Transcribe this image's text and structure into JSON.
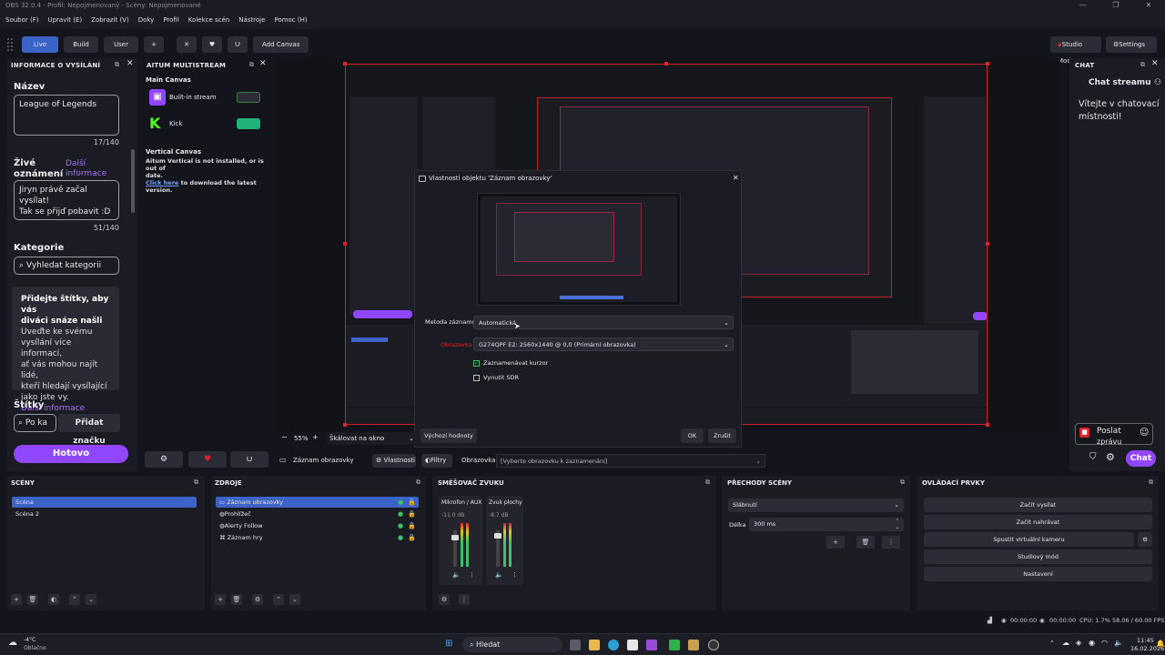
{
  "window": {
    "title": "OBS 32.0.4 - Profil: Nepojmenovaný - Scény: Nepojmenované",
    "controls": [
      "—",
      "❐",
      "✕"
    ]
  },
  "menubar": [
    "Soubor (F)",
    "Upravit (E)",
    "Zobrazit (V)",
    "Doky",
    "Profil",
    "Kolekce scén",
    "Nástroje",
    "Pomoc (H)"
  ],
  "toolbar": {
    "tabs": [
      "Live",
      "Build",
      "User"
    ],
    "active_tab": "Live",
    "add_tab": "+",
    "add_canvas": "Add Canvas",
    "studio_mode": "Studio Mode",
    "settings": "Settings"
  },
  "info_panel": {
    "title": "INFORMACE O VYSÍLÁNÍ",
    "name_label": "Název",
    "name_value": "League of Legends",
    "name_counter": "17/140",
    "live_label_1": "Živé",
    "live_label_2": "oznámení",
    "more_info_1": "Další",
    "more_info_2": "informace",
    "live_value_1": "Jiryn právě začal vysílat!",
    "live_value_2": "Tak se přijď pobavit :D",
    "live_counter": "51/140",
    "category_label": "Kategorie",
    "category_placeholder": "Vyhledat kategorii",
    "tip_bold_1": "Přidejte štítky, aby vás",
    "tip_bold_2": "diváci snáze našli",
    "tip_1": "Uveďte ke svému",
    "tip_2": "vysílání více informací,",
    "tip_3": "ať vás mohou najít lidé,",
    "tip_4": "kteří hledají vysílající",
    "tip_5": "jako jste vy.",
    "tip_link": "Další informace",
    "tags_label": "Štítky",
    "tags_placeholder": "Po ka",
    "add_tag": "Přidat značku",
    "done": "Hotovo"
  },
  "aitum": {
    "title": "AITUM MULTISTREAM",
    "main_canvas": "Main Canvas",
    "outputs": [
      {
        "name": "Built-in stream",
        "on": false
      },
      {
        "name": "Kick",
        "on": true
      }
    ],
    "vertical_canvas": "Vertical Canvas",
    "warn_1": "Aitum Vertical is not installed, or is out of",
    "warn_2": "date.",
    "warn_link": "Click here",
    "warn_3": " to download the latest version."
  },
  "dialog": {
    "title": "Vlastnosti objektu 'Záznam obrazovky'",
    "method_label": "Metoda záznamu",
    "method_value": "Automatická",
    "screen_label": "Obrazovka",
    "screen_value": "G274QPF E2: 2560x1440 @ 0,0 (Primární obrazovka)",
    "cursor_label": "Zaznamenávat kurzor",
    "cursor_checked": true,
    "sdr_label": "Vynutit SDR",
    "sdr_checked": false,
    "defaults": "Výchozí hodnoty",
    "ok": "OK",
    "cancel": "Zrušit"
  },
  "chat": {
    "title": "CHAT",
    "header": "Chat streamu",
    "welcome_1": "Vítejte v chatovací",
    "welcome_2": "místnosti!",
    "send_1": "Poslat",
    "send_2": "zprávu",
    "chat_btn": "Chat"
  },
  "preview_bar": {
    "minus": "−",
    "zoom": "55%",
    "plus": "+",
    "scale": "Škálovat na okno"
  },
  "source_bar": {
    "source_name": "Záznam obrazovky",
    "properties": "Vlastnosti",
    "filters": "Filtry",
    "screen_label": "Obrazovka",
    "screen_placeholder": "[Vyberte obrazovku k zaznamenání]"
  },
  "scenes": {
    "title": "SCÉNY",
    "items": [
      "Scéna",
      "Scéna 2"
    ],
    "selected": 0
  },
  "sources": {
    "title": "ZDROJE",
    "items": [
      "Záznam obrazovky",
      "Prohlížeč",
      "Alerty Follow",
      "Záznam hry"
    ],
    "selected": 0
  },
  "mixer": {
    "title": "SMĚŠOVAČ ZVUKU",
    "channels": [
      {
        "name": "Mikrofon / AUX",
        "db": "-11.0 dB"
      },
      {
        "name": "Zvuk plochy",
        "db": "-8.7 dB"
      }
    ]
  },
  "transitions": {
    "title": "PŘECHODY SCÉNY",
    "type": "Slábnutí",
    "duration_label": "Délka",
    "duration_value": "300 ms"
  },
  "controls": {
    "title": "OVLÁDACÍ PRVKY",
    "buttons": [
      "Začít vysílat",
      "Začít nahrávat",
      "Spustit virtuální kameru",
      "Studiový mód",
      "Nastavení"
    ]
  },
  "status": {
    "stream_time": "00:00:00",
    "rec_time": "00:00:00",
    "cpu": "CPU: 1.7%",
    "fps": "58.06 / 60.00 FPS"
  },
  "taskbar": {
    "weather_temp": "-4°C",
    "weather_desc": "Oblačno",
    "search": "Hledat",
    "time": "11:45",
    "date": "16.02.2026"
  },
  "colors": {
    "accent_blue": "#3c63c7",
    "twitch_purple": "#9147ff",
    "kick_green": "#53fc18",
    "red_bounds": "#e0222c",
    "panel_bg": "#1b1c23"
  }
}
